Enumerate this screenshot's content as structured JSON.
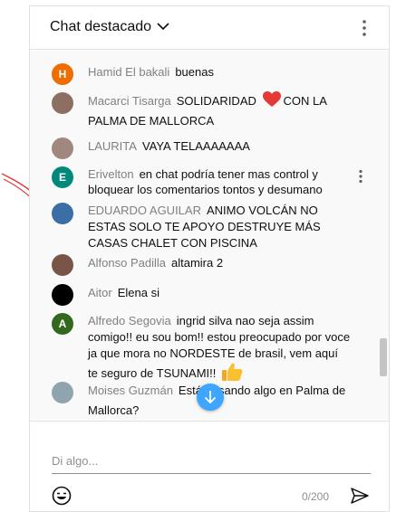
{
  "header": {
    "title": "Chat destacado"
  },
  "messages": [
    {
      "author": "Hamid El bakali",
      "text": "buenas",
      "avatar_letter": "H",
      "avatar_color": "#ef6c00"
    },
    {
      "author": "Macarci Tisarga",
      "text": "SOLIDARIDAD",
      "text2": "CON LA PALMA DE MALLORCA",
      "avatar_letter": "",
      "avatar_color": "#8d6e63"
    },
    {
      "author": "LAURITA",
      "text": "VAYA TELAAAAAAA",
      "avatar_letter": "",
      "avatar_color": "#a1887f"
    },
    {
      "author": "Erivelton",
      "text": "en chat podría tener mas control y bloquear los comentarios tontos y desumano",
      "avatar_letter": "E",
      "avatar_color": "#00897b"
    },
    {
      "author": "EDUARDO AGUILAR",
      "text": "ANIMO VOLCÁN NO ESTAS SOLO TE APOYO DESTRUYE MÁS CASAS CHALET CON PISCINA",
      "avatar_letter": "",
      "avatar_color": "#3a6ea5"
    },
    {
      "author": "Alfonso Padilla",
      "text": "altamira 2",
      "avatar_letter": "",
      "avatar_color": "#795548"
    },
    {
      "author": "Aitor",
      "text": "Elena si",
      "avatar_letter": "",
      "avatar_color": "#000000"
    },
    {
      "author": "Alfredo Segovia",
      "text": "ingrid silva nao seja assim comigo!! eu sou bom!! estou preocupado por voce ja que mora no NORDESTE de brasil, vem aquí te seguro de TSUNAMI!!",
      "avatar_letter": "A",
      "avatar_color": "#33691e"
    },
    {
      "author": "Moises Guzmán",
      "text": "Está pasando algo en Palma de Mallorca?",
      "avatar_letter": "",
      "avatar_color": "#90a4ae"
    }
  ],
  "footer": {
    "placeholder": "Di algo...",
    "counter": "0/200"
  },
  "colors": {
    "accent": "#3ea6ff",
    "author": "#808080",
    "heart": "#e53935",
    "annotation": "#e53935"
  }
}
